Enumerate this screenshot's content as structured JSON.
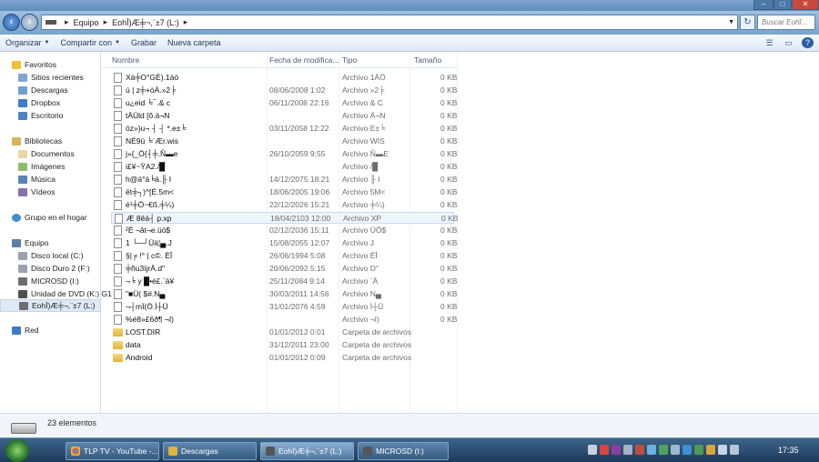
{
  "address": {
    "crumbs": [
      "Equipo",
      "EohĪ)Æ╪¬,¨±7 (L:)"
    ],
    "search_placeholder": "Buscar Eohĩ..."
  },
  "toolbar": {
    "organize": "Organizar",
    "share": "Compartir con",
    "burn": "Grabar",
    "new_folder": "Nueva carpeta"
  },
  "nav": {
    "favorites": "Favoritos",
    "recent": "Sitios recientes",
    "downloads": "Descargas",
    "dropbox": "Dropbox",
    "desktop": "Escritorio",
    "libraries": "Bibliotecas",
    "documents": "Documentos",
    "images": "Imágenes",
    "music": "Música",
    "videos": "Vídeos",
    "homegroup": "Grupo en el hogar",
    "computer": "Equipo",
    "local_disk": "Disco local (C:)",
    "hard_disk_2": "Disco Duro 2 (F:)",
    "microsd": "MICROSD (I:)",
    "dvd": "Unidad de DVD (K:) G1",
    "current_drive": "EohĪ)Æ╪¬,¨±7 (L:)",
    "network": "Red"
  },
  "columns": {
    "name": "Nombre",
    "date": "Fecha de modifica...",
    "type": "Tipo",
    "size": "Tamaño"
  },
  "files": [
    {
      "name": "Xä╪O°GÈ).1äö",
      "date": "",
      "type": "Archivo 1ÄÖ",
      "size": "0 KB"
    },
    {
      "name": "ú | z╪+òÀ.»2╞",
      "date": "08/06/2008 1:02",
      "type": "Archivo »2╞",
      "size": "0 KB"
    },
    {
      "name": "u¿eid ╘¯.& c",
      "date": "06/11/2008 22:16",
      "type": "Archivo & C",
      "size": "0 KB"
    },
    {
      "name": "tÄÜld [ô.ä¬N",
      "date": "",
      "type": "Archivo Ä¬N",
      "size": "0 KB"
    },
    {
      "name": "öz»}u¬ ┤ ┤ *.e±╘",
      "date": "03/11/2058 12:22",
      "type": "Archivo E±╘",
      "size": "0 KB"
    },
    {
      "name": "NÉ9ü ╘¨Ær.wis",
      "date": "",
      "type": "Archivo WIS",
      "size": "0 KB"
    },
    {
      "name": "j»{_Ö{┤╪.Ñ▬e",
      "date": "26/10/2059 9:55",
      "type": "Archivo Ñ▬E",
      "size": "0 KB"
    },
    {
      "name": "i£¥~ŸA2./█",
      "date": "",
      "type": "Archivo /█",
      "size": "0 KB"
    },
    {
      "name": "h@ä°ä╘ä.╟ I",
      "date": "14/12/2075 18:21",
      "type": "Archivo ╟ I",
      "size": "0 KB"
    },
    {
      "name": "ët╪┐)^[É.5m<",
      "date": "18/06/2005 19:06",
      "type": "Archivo 5M<",
      "size": "0 KB"
    },
    {
      "name": "é¹╪Ö~€ß.╪¼)",
      "date": "22/12/2026 15:21",
      "type": "Archivo ╪¼)",
      "size": "0 KB"
    },
    {
      "name": "Æ 8êä┤ p.xp",
      "date": "18/04/2103 12:00",
      "type": "Archivo XP",
      "size": "0 KB",
      "selected": true
    },
    {
      "name": "²É ¬ât¬e.üö$",
      "date": "02/12/2036 15:11",
      "type": "Archivo ÜÖ$",
      "size": "0 KB"
    },
    {
      "name": "1 └─┘Üä¦▄.J",
      "date": "15/08/2055 12:07",
      "type": "Archivo J",
      "size": "0 KB"
    },
    {
      "name": "§|╒ !° | c©. ÈÎ",
      "date": "26/06/1994 5:08",
      "type": "Archivo ÈÎ",
      "size": "0 KB"
    },
    {
      "name": "╪ñu3ìjrÄ.d''",
      "date": "20/06/2092 5:15",
      "type": "Archivo D''",
      "size": "0 KB"
    },
    {
      "name": "¬╘ y █•é£.`ä¥",
      "date": "25/11/2084 9:14",
      "type": "Archivo `Ä",
      "size": "0 KB"
    },
    {
      "name": "\"■Ü( $#.N▄",
      "date": "30/03/2011 14:56",
      "type": "Archivo N▄",
      "size": "0 KB"
    },
    {
      "name": "¬┤mÏ(Ö.Ì┼Ü",
      "date": "31/01/2076 4:59",
      "type": "Archivo Ì┼Ü",
      "size": "0 KB"
    },
    {
      "name": "%é8»£6ð¶ ¬I)",
      "date": "",
      "type": "Archivo ¬I)",
      "size": "0 KB"
    },
    {
      "name": "LOST.DIR",
      "date": "01/01/2012 0:01",
      "type": "Carpeta de archivos",
      "size": "",
      "folder": true
    },
    {
      "name": "data",
      "date": "31/12/2011 23:00",
      "type": "Carpeta de archivos",
      "size": "",
      "folder": true
    },
    {
      "name": "Android",
      "date": "01/01/2012 0:09",
      "type": "Carpeta de archivos",
      "size": "",
      "folder": true
    }
  ],
  "status": {
    "count": "23 elementos"
  },
  "taskbar": {
    "tasks": [
      "TLP TV - YouTube -...",
      "Descargas",
      "EohĪ)Æ╪¬,¨±7 (L:)",
      "MICROSD (I:)"
    ],
    "clock": "17:35"
  },
  "colors": {
    "accent": "#2a5ea5",
    "folder": "#e3b33a",
    "taskbar": "#1d3b5c"
  }
}
